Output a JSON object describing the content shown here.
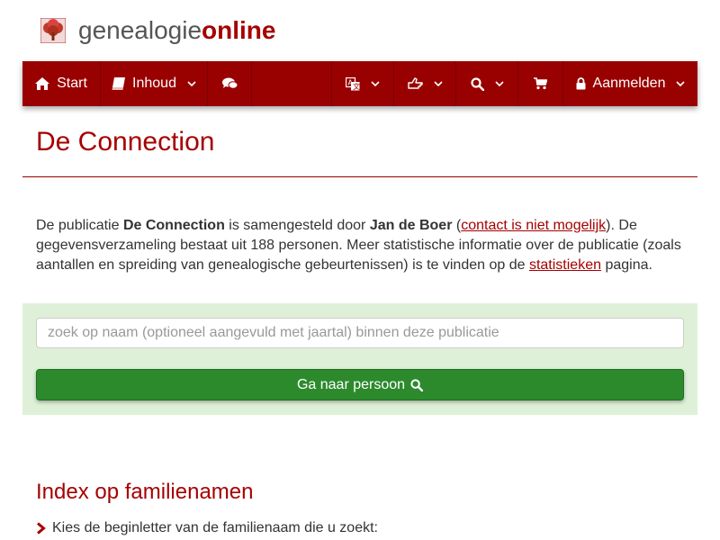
{
  "site": {
    "logo_text_main": "genealogie",
    "logo_text_accent": "online",
    "logo_icon": "tree-icon"
  },
  "navbar": {
    "background_color": "#990000",
    "items": [
      {
        "label": "Start",
        "icon": "home-icon"
      },
      {
        "label": "Inhoud",
        "icon": "book-icon",
        "dropdown": true
      },
      {
        "label": "",
        "icon": "comments-icon"
      },
      {
        "label": "",
        "icon": "translate-icon",
        "dropdown": true
      },
      {
        "label": "",
        "icon": "hand-pointer-icon",
        "dropdown": true
      },
      {
        "label": "",
        "icon": "search-icon",
        "dropdown": true
      },
      {
        "label": "",
        "icon": "shopping-cart-icon"
      },
      {
        "label": "Aanmelden",
        "icon": "lock-icon",
        "dropdown": true
      }
    ]
  },
  "page": {
    "title": "De Connection",
    "title_color": "#a60000"
  },
  "intro": {
    "part1": "De publicatie ",
    "publication": "De Connection",
    "part2": " is samengesteld door ",
    "author": "Jan de Boer",
    "part3": " (",
    "contact_link": "contact is niet mogelijk",
    "part4": "). De gegevensverzameling bestaat uit 188 personen. Meer statistische informatie over de publicatie (zoals aantallen en spreiding van genealogische gebeurtenissen) is te vinden op de ",
    "stats_link": "statistieken",
    "part5": " pagina."
  },
  "search": {
    "placeholder": "zoek op naam (optioneel aangevuld met jaartal) binnen deze publicatie",
    "value": "",
    "button_label": "Ga naar persoon",
    "button_icon": "search-icon",
    "panel_color": "#dff0d8",
    "button_color": "#2c8a2c"
  },
  "index": {
    "title": "Index op familienamen",
    "instruction": "Kies de beginletter van de familienaam die u zoekt:",
    "instruction_icon": "chevron-right-icon"
  }
}
